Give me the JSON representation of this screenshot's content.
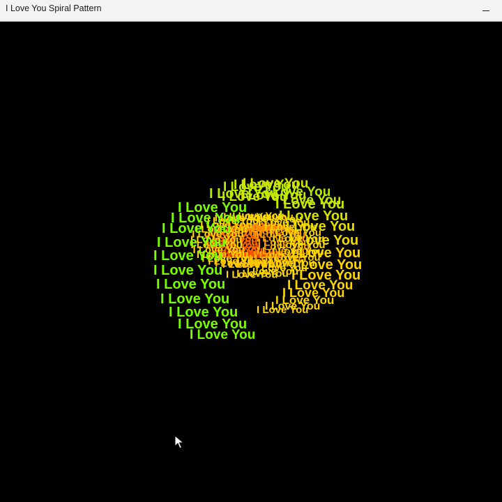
{
  "window": {
    "title": "I Love You Spiral Pattern",
    "minimize_icon": "minimize-icon"
  },
  "spiral": {
    "phrase": "I Love You",
    "background_color": "#000000",
    "colors": {
      "outer": "#7CFC00",
      "middle": "#FFD700",
      "inner": "#FF4500"
    }
  },
  "cursor": {
    "icon": "mouse-pointer-icon"
  }
}
